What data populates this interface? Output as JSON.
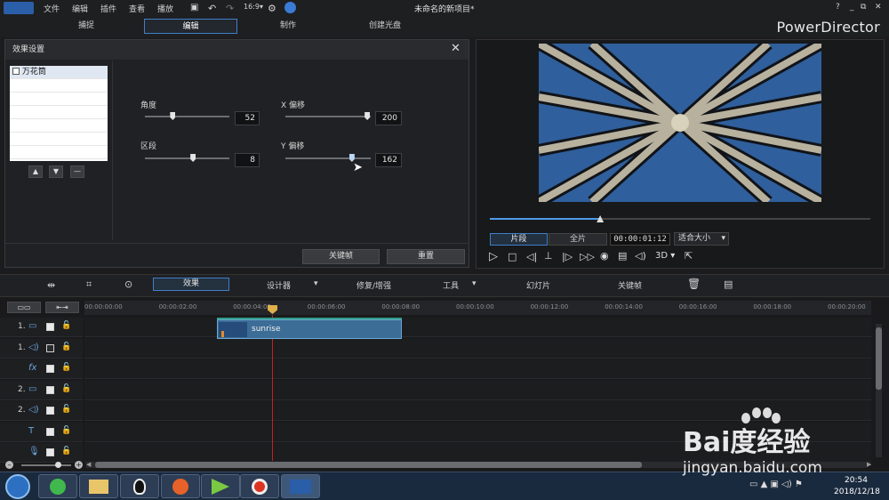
{
  "menu": [
    "文件",
    "编辑",
    "插件",
    "查看",
    "播放"
  ],
  "title": "未命名的新项目*",
  "brand": "PowerDirector",
  "window_controls": [
    "?",
    "_",
    "⧉",
    "✕"
  ],
  "modes": [
    {
      "label": "捕捉"
    },
    {
      "label": "编辑",
      "active": true
    },
    {
      "label": "制作"
    },
    {
      "label": "创建光盘"
    }
  ],
  "fx_panel": {
    "title": "效果设置",
    "effect_name": "万花筒",
    "params": {
      "angle": {
        "label": "角度",
        "value": "52",
        "level": 0.33
      },
      "segment": {
        "label": "区段",
        "value": "8",
        "level": 0.57
      },
      "x_offset": {
        "label": "X 偏移",
        "value": "200",
        "level": 0.96
      },
      "y_offset": {
        "label": "Y 偏移",
        "value": "162",
        "level": 0.78
      }
    },
    "keyframe_label": "关键帧",
    "reset_label": "重置"
  },
  "preview": {
    "clip_tab": "片段",
    "full_tab": "全片",
    "timecode": "00:00:01:12",
    "fit_label": "适合大小",
    "mode_3d": "3D",
    "progress": 0.29
  },
  "edit_toolbar": {
    "effect": "效果",
    "designer": "设计器",
    "repair": "修复/增强",
    "tools": "工具",
    "slideshow": "幻灯片",
    "keyframe": "关键帧"
  },
  "timeline": {
    "ticks": [
      "00:00:00:00",
      "00:00:02:00",
      "00:00:04:00",
      "00:00:06:00",
      "00:00:08:00",
      "00:00:10:00",
      "00:00:12:00",
      "00:00:14:00",
      "00:00:16:00",
      "00:00:18:00",
      "00:00:20:00"
    ],
    "clip_name": "sunrise",
    "tracks": [
      {
        "num": "1.",
        "type": "video"
      },
      {
        "num": "1.",
        "type": "audio"
      },
      {
        "num": "",
        "type": "fx"
      },
      {
        "num": "2.",
        "type": "video"
      },
      {
        "num": "2.",
        "type": "audio"
      },
      {
        "num": "",
        "type": "title"
      },
      {
        "num": "",
        "type": "voice"
      }
    ]
  },
  "taskbar": {
    "time": "20:54",
    "date": "2018/12/18"
  },
  "watermark": {
    "brand": "Bai度经验",
    "url": "jingyan.baidu.com"
  }
}
